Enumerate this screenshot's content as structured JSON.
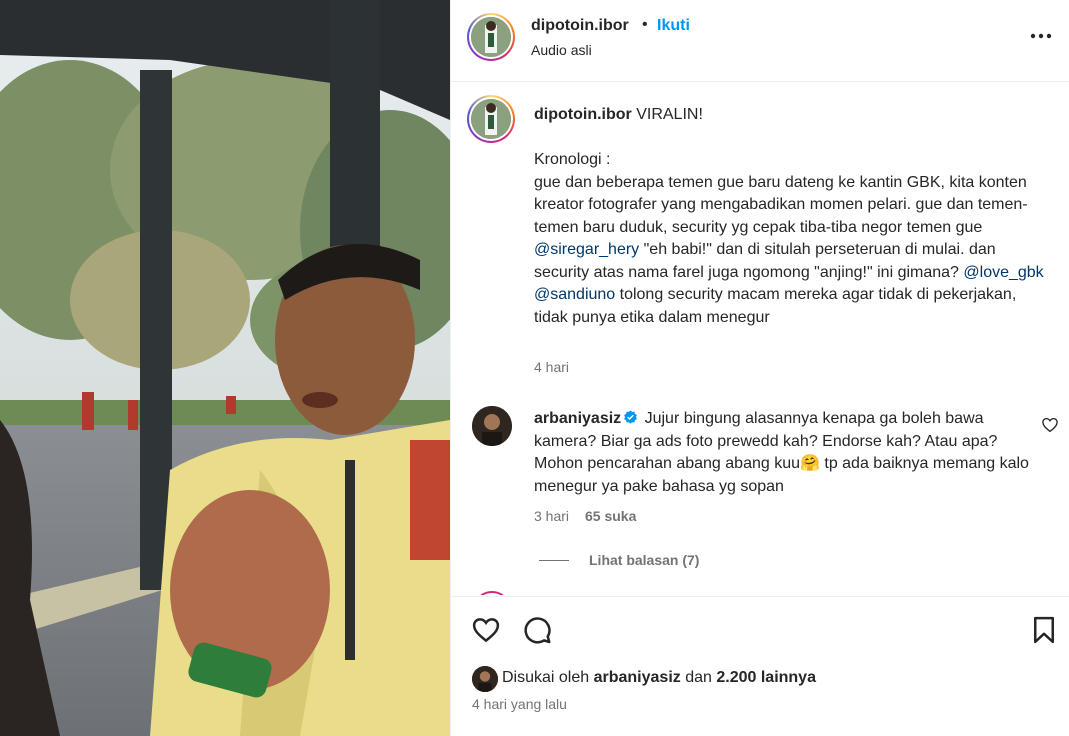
{
  "colors": {
    "link_blue": "#0095f6",
    "mention": "#00376b",
    "muted_text": "#737373",
    "text": "#262626",
    "border": "#efefef"
  },
  "media": {
    "description_icon": "video-frame"
  },
  "header": {
    "username": "dipotoin.ibor",
    "separator": "•",
    "follow_label": "Ikuti",
    "audio_label": "Audio asli",
    "more_icon": "more-horizontal-icon"
  },
  "caption": {
    "username": "dipotoin.ibor",
    "text_1": " VIRALIN!",
    "kronologi": "Kronologi :",
    "line_a": "gue dan beberapa temen gue baru dateng ke kantin GBK, kita konten kreator fotografer yang mengabadikan momen pelari. gue dan temen-temen baru duduk, security yg cepak tiba-tiba negor temen gue ",
    "mention_1": "@siregar_hery",
    "line_b": " \"eh babi!\" dan di situlah perseteruan di mulai. dan security atas nama farel juga ngomong \"anjing!\" ini gimana? ",
    "mention_2": "@love_gbk",
    "line_c": " ",
    "mention_3": "@sandiuno",
    "line_d": " tolong security macam mereka agar tidak di pekerjakan, tidak punya etika dalam menegur",
    "time": "4 hari"
  },
  "comment": {
    "username": "arbaniyasiz",
    "verified_icon": "verified-badge-icon",
    "text": " Jujur bingung alasannya kenapa ga boleh bawa kamera? Biar ga ads foto prewedd kah? Endorse kah? Atau apa? Mohon pencarahan abang abang kuu",
    "emoji": "🤗",
    "text_2": " tp ada baiknya memang kalo menegur ya pake bahasa yg sopan",
    "time": "3 hari",
    "likes": "65 suka",
    "view_replies": "Lihat balasan (7)",
    "heart_icon": "heart-outline-icon"
  },
  "actions": {
    "like_icon": "heart-icon",
    "comment_icon": "comment-icon",
    "save_icon": "bookmark-icon",
    "liked_prefix": "Disukai oleh ",
    "liked_user": "arbaniyasiz",
    "liked_middle": " dan ",
    "liked_count": "2.200 lainnya",
    "post_time": "4 hari yang lalu"
  }
}
